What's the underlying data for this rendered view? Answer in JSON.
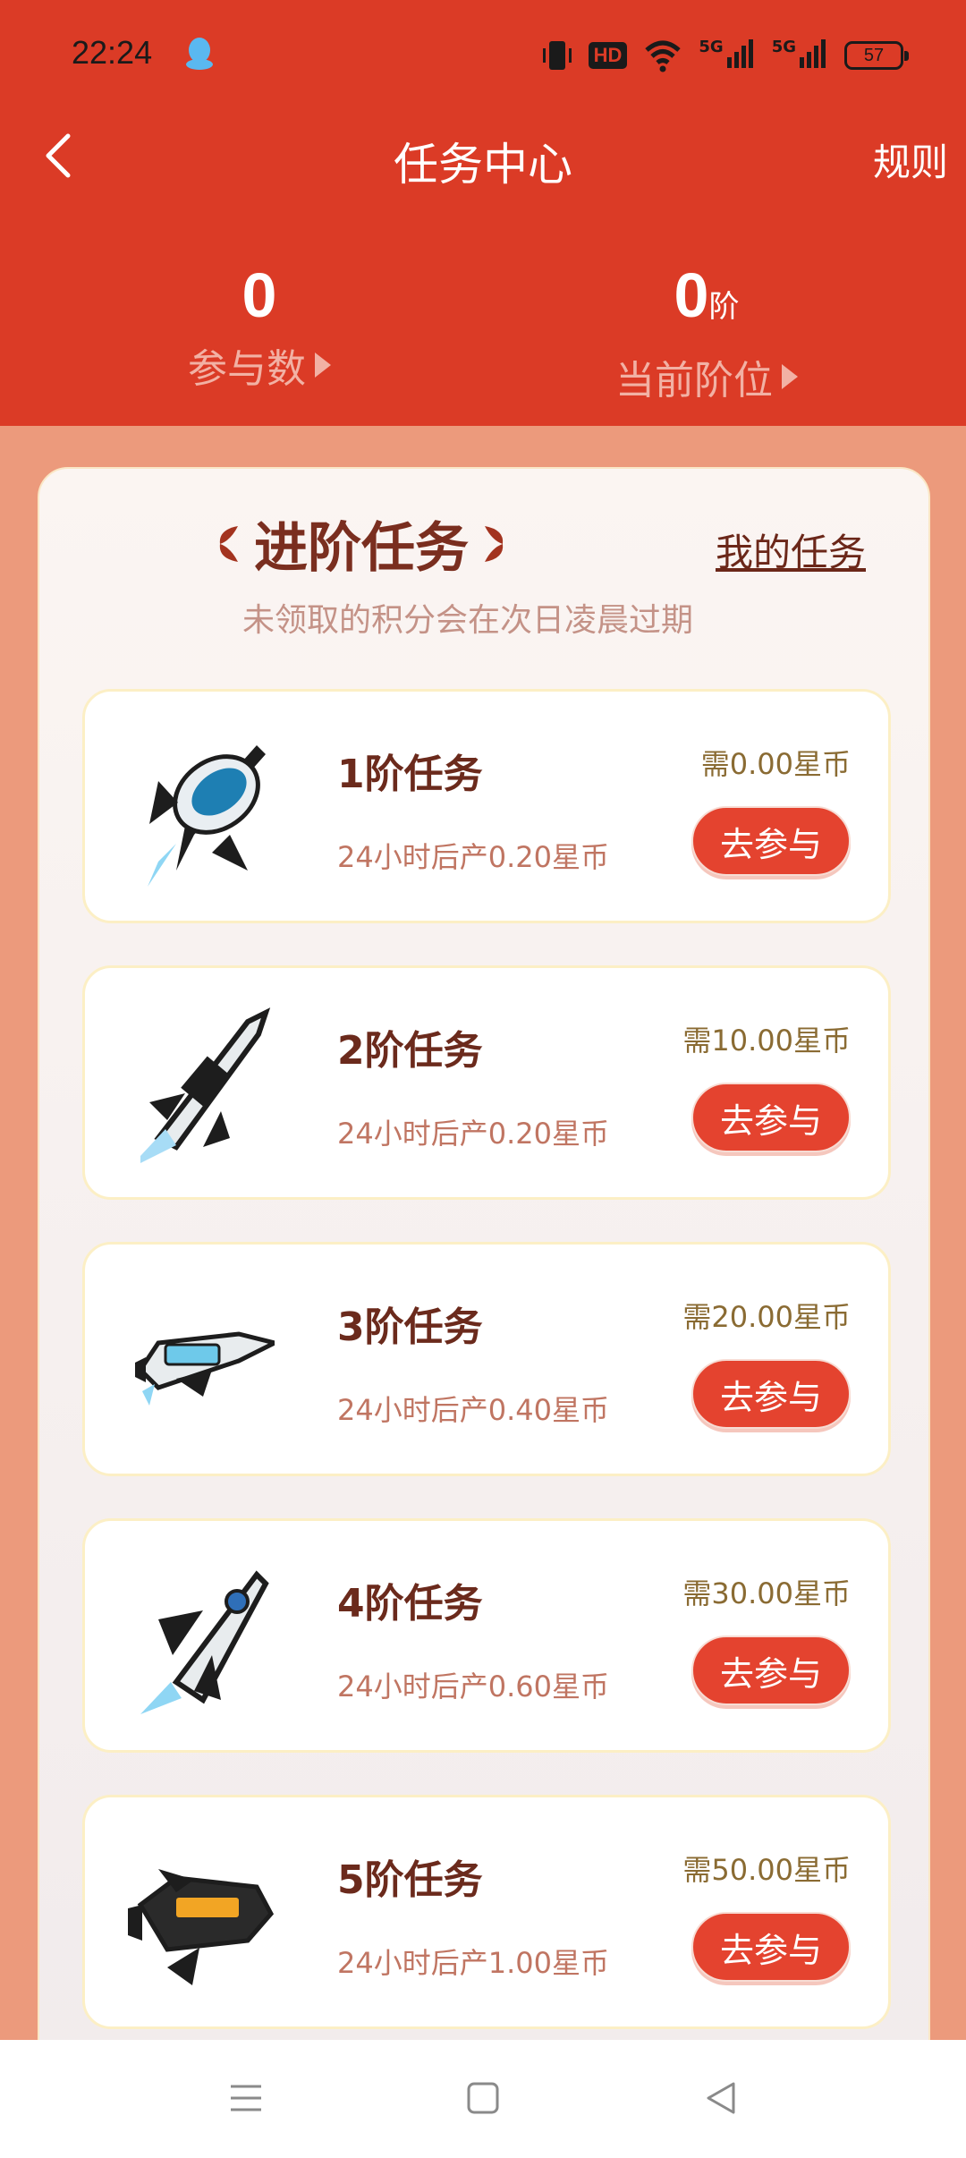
{
  "status_bar": {
    "time": "22:24",
    "hd": "HD",
    "net1": "5G",
    "net2": "5G",
    "battery": "57"
  },
  "navbar": {
    "title": "任务中心",
    "rules": "规则"
  },
  "stats": [
    {
      "value": "0",
      "unit": "",
      "label": "参与数"
    },
    {
      "value": "0",
      "unit": "阶",
      "label": "当前阶位"
    }
  ],
  "section": {
    "title": "进阶任务",
    "my_tasks": "我的任务",
    "subtitle": "未领取的积分会在次日凌晨过期"
  },
  "tasks": [
    {
      "name": "1阶任务",
      "yield": "24小时后产0.20星币",
      "required": "需0.00星币",
      "button": "去参与"
    },
    {
      "name": "2阶任务",
      "yield": "24小时后产0.20星币",
      "required": "需10.00星币",
      "button": "去参与"
    },
    {
      "name": "3阶任务",
      "yield": "24小时后产0.40星币",
      "required": "需20.00星币",
      "button": "去参与"
    },
    {
      "name": "4阶任务",
      "yield": "24小时后产0.60星币",
      "required": "需30.00星币",
      "button": "去参与"
    },
    {
      "name": "5阶任务",
      "yield": "24小时后产1.00星币",
      "required": "需50.00星币",
      "button": "去参与"
    }
  ],
  "colors": {
    "header": "#db3b26",
    "background": "#ec9a7c",
    "button": "#e4432f",
    "title": "#7a2e1f"
  }
}
